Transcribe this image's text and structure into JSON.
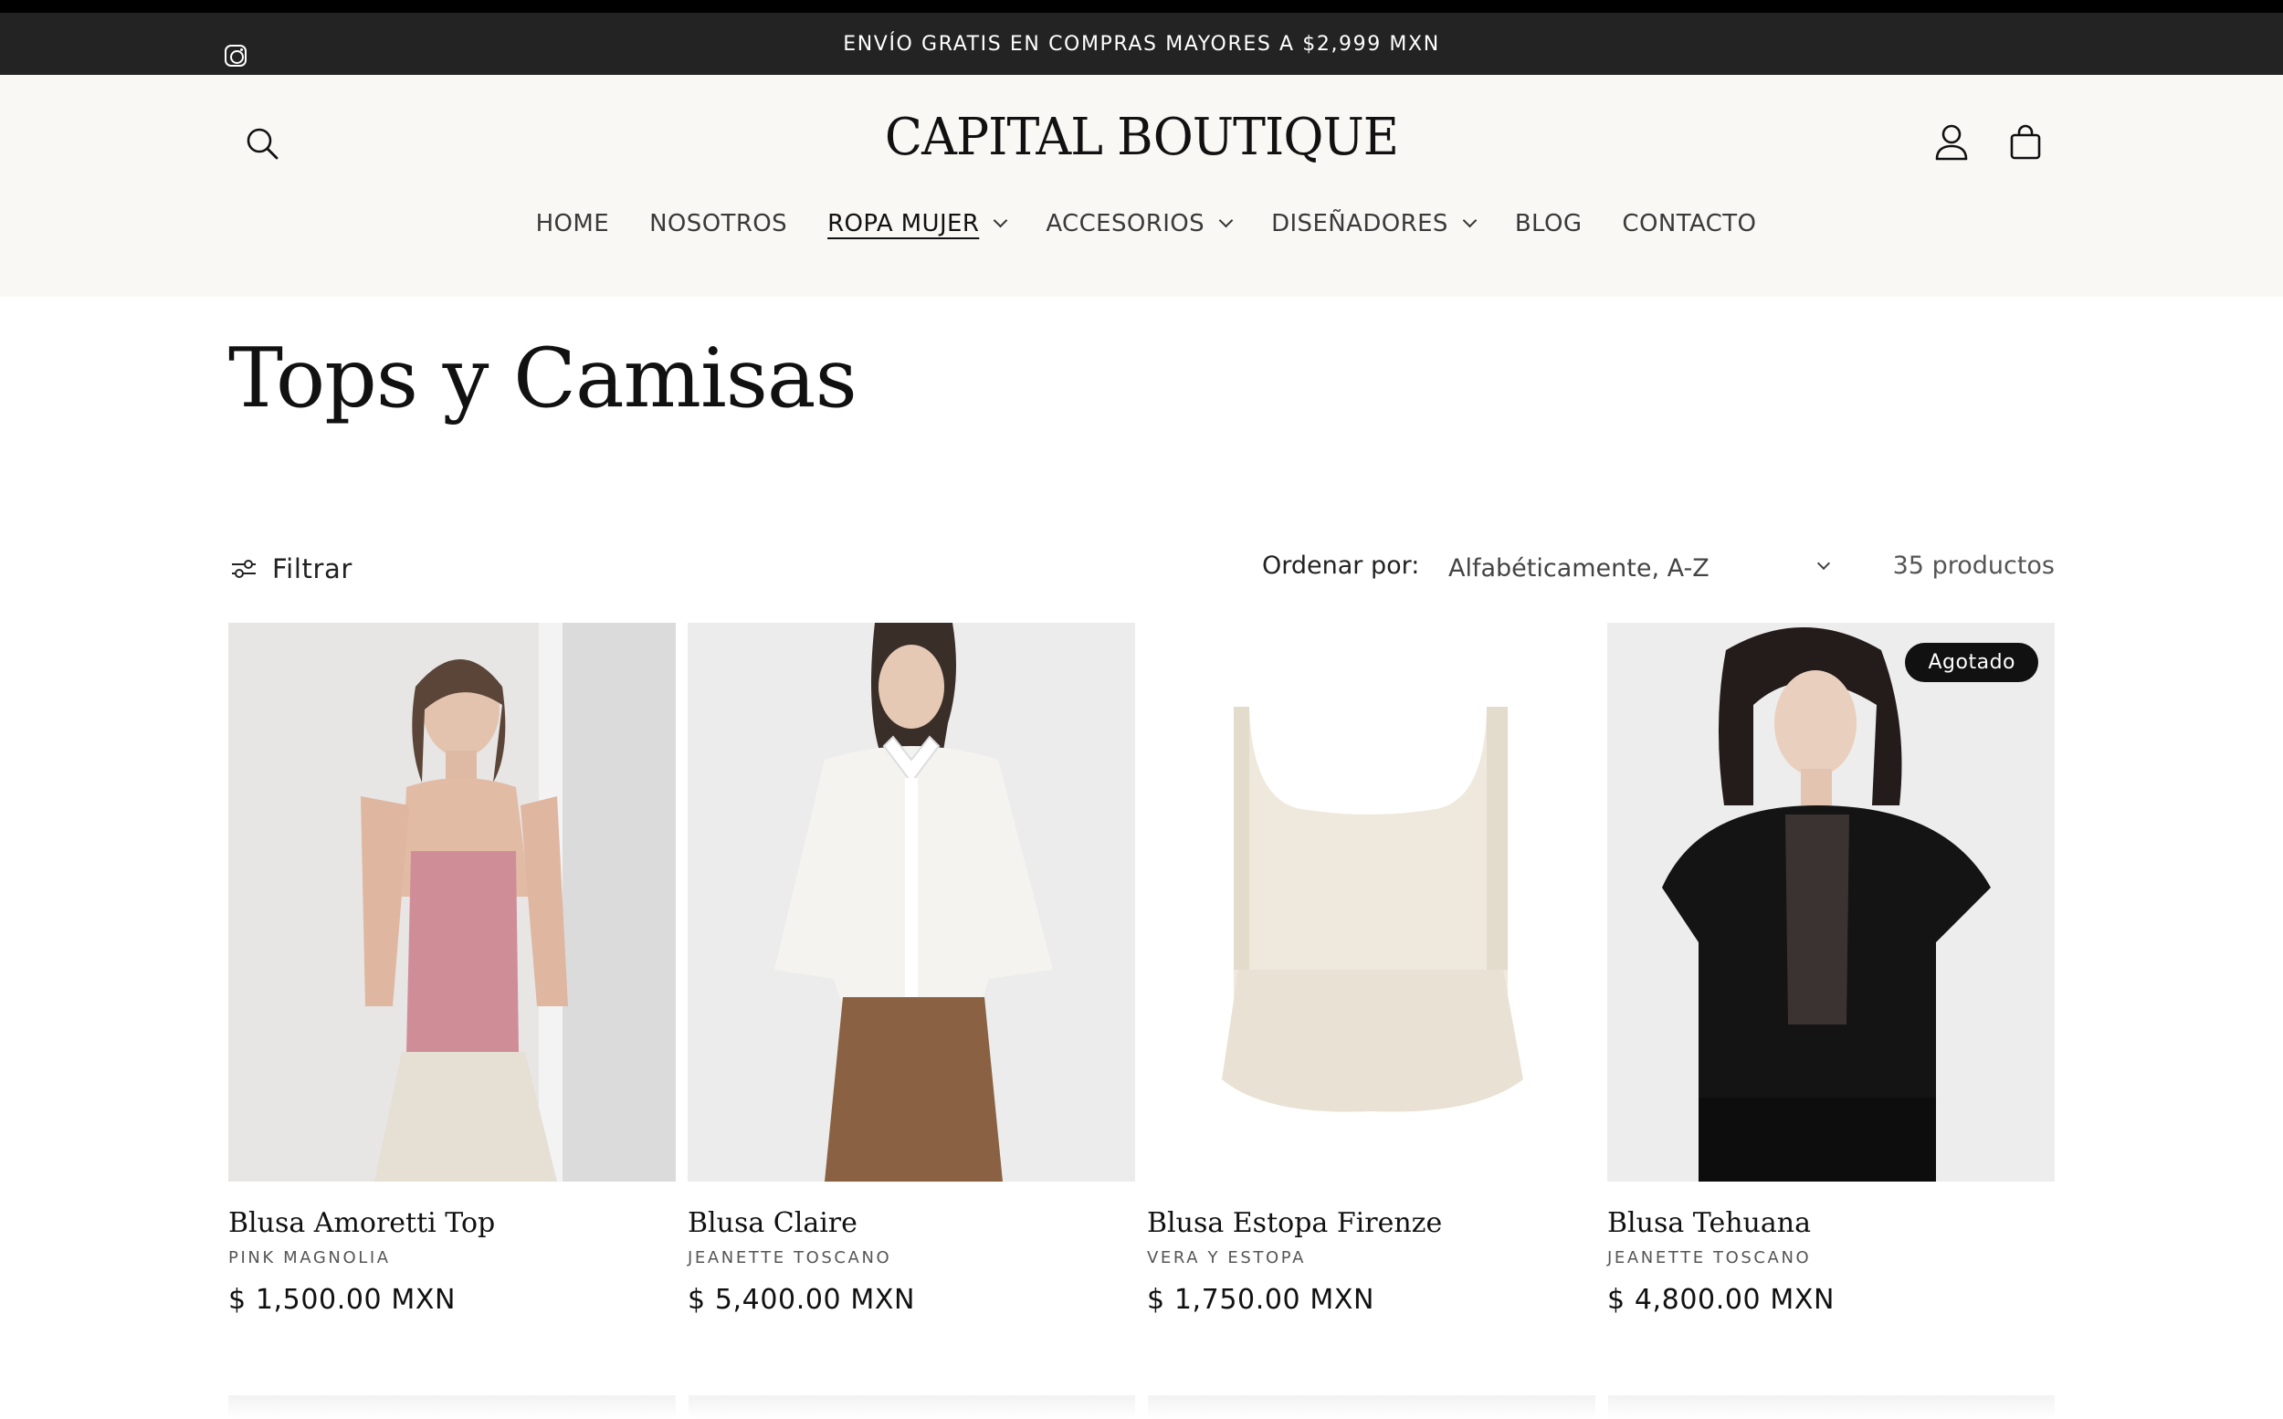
{
  "announcement": {
    "text": "ENVÍO GRATIS EN COMPRAS MAYORES A $2,999 MXN",
    "social_icon": "instagram-icon"
  },
  "header": {
    "logo": "CAPITAL BOUTIQUE",
    "icons": {
      "search": "search-icon",
      "account": "user-icon",
      "cart": "cart-icon"
    },
    "nav": [
      {
        "label": "HOME",
        "dropdown": false
      },
      {
        "label": "NOSOTROS",
        "dropdown": false
      },
      {
        "label": "ROPA MUJER",
        "dropdown": true,
        "active": true
      },
      {
        "label": "ACCESORIOS",
        "dropdown": true
      },
      {
        "label": "DISEÑADORES",
        "dropdown": true
      },
      {
        "label": "BLOG",
        "dropdown": false
      },
      {
        "label": "CONTACTO",
        "dropdown": false
      }
    ]
  },
  "collection": {
    "title": "Tops y Camisas",
    "filter_label": "Filtrar",
    "sort_label": "Ordenar por:",
    "sort_value": "Alfabéticamente, A-Z",
    "product_count": "35 productos"
  },
  "products": [
    {
      "name": "Blusa Amoretti Top",
      "vendor": "PINK MAGNOLIA",
      "price": "$ 1,500.00 MXN",
      "badge": "",
      "image": "pink ribbed tank top"
    },
    {
      "name": "Blusa Claire",
      "vendor": "JEANETTE TOSCANO",
      "price": "$ 5,400.00 MXN",
      "badge": "",
      "image": "white lace blouse"
    },
    {
      "name": "Blusa Estopa Firenze",
      "vendor": "VERA Y ESTOPA",
      "price": "$ 1,750.00 MXN",
      "badge": "",
      "image": "cream lace peplum top"
    },
    {
      "name": "Blusa Tehuana",
      "vendor": "JEANETTE TOSCANO",
      "price": "$ 4,800.00 MXN",
      "badge": "Agotado",
      "image": "black tulle ruffle blouse"
    }
  ],
  "colors": {
    "announcement_bg": "#232323",
    "header_bg": "#faf8f5",
    "badge_bg": "#111111"
  }
}
